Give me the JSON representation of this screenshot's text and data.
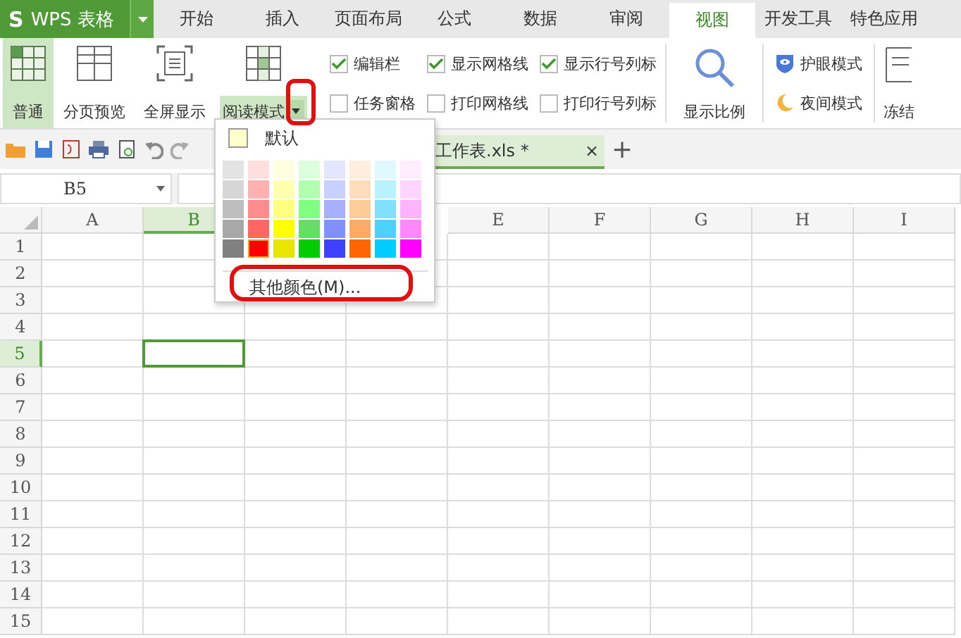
{
  "app": {
    "logo": "S",
    "name": "WPS 表格"
  },
  "tabs": [
    {
      "label": "开始",
      "selected": false
    },
    {
      "label": "插入",
      "selected": false
    },
    {
      "label": "页面布局",
      "selected": false
    },
    {
      "label": "公式",
      "selected": false
    },
    {
      "label": "数据",
      "selected": false
    },
    {
      "label": "审阅",
      "selected": false
    },
    {
      "label": "视图",
      "selected": true
    },
    {
      "label": "开发工具",
      "selected": false
    },
    {
      "label": "特色应用",
      "selected": false
    }
  ],
  "view_buttons": [
    {
      "label": "普通",
      "kind": "normal",
      "selected": true
    },
    {
      "label": "分页预览",
      "kind": "pagebreak",
      "selected": false
    },
    {
      "label": "全屏显示",
      "kind": "fullscreen",
      "selected": false
    },
    {
      "label": "阅读模式",
      "kind": "reading",
      "selected": false
    }
  ],
  "checkbox_columns": [
    [
      {
        "label": "编辑栏",
        "checked": true
      },
      {
        "label": "任务窗格",
        "checked": false
      }
    ],
    [
      {
        "label": "显示网格线",
        "checked": true
      },
      {
        "label": "打印网格线",
        "checked": false
      }
    ],
    [
      {
        "label": "显示行号列标",
        "checked": true
      },
      {
        "label": "打印行号列标",
        "checked": false
      }
    ]
  ],
  "zoom_button": {
    "label": "显示比例"
  },
  "mode_buttons": [
    {
      "label": "护眼模式",
      "kind": "eye"
    },
    {
      "label": "夜间模式",
      "kind": "night"
    }
  ],
  "freeze_button": {
    "label": "冻结"
  },
  "document_tab": {
    "title": "工作表.xls *",
    "close": "×",
    "add": "+"
  },
  "name_box": {
    "value": "B5"
  },
  "color_menu": {
    "default_label": "默认",
    "swatches": [
      [
        {
          "color": "#e3e3e3",
          "selected": false
        },
        {
          "color": "#ffdede",
          "selected": false
        },
        {
          "color": "#ffffe0",
          "selected": false
        },
        {
          "color": "#dcffdc",
          "selected": false
        },
        {
          "color": "#e2e6ff",
          "selected": false
        },
        {
          "color": "#ffeedd",
          "selected": false
        },
        {
          "color": "#e0f8ff",
          "selected": false
        },
        {
          "color": "#ffeeff",
          "selected": false
        }
      ],
      [
        {
          "color": "#d6d6d6",
          "selected": false
        },
        {
          "color": "#ffb0b0",
          "selected": false
        },
        {
          "color": "#ffffb0",
          "selected": false
        },
        {
          "color": "#b0ffb0",
          "selected": false
        },
        {
          "color": "#c8d0ff",
          "selected": false
        },
        {
          "color": "#ffdcbc",
          "selected": false
        },
        {
          "color": "#b8f2ff",
          "selected": false
        },
        {
          "color": "#ffd4ff",
          "selected": false
        }
      ],
      [
        {
          "color": "#bdbdbd",
          "selected": false
        },
        {
          "color": "#ff8c8c",
          "selected": false
        },
        {
          "color": "#ffff80",
          "selected": false
        },
        {
          "color": "#80ff80",
          "selected": false
        },
        {
          "color": "#a6b0ff",
          "selected": false
        },
        {
          "color": "#ffcc99",
          "selected": false
        },
        {
          "color": "#80e0ff",
          "selected": false
        },
        {
          "color": "#ffb3ff",
          "selected": false
        }
      ],
      [
        {
          "color": "#a8a8a8",
          "selected": false
        },
        {
          "color": "#ff6666",
          "selected": false
        },
        {
          "color": "#ffff00",
          "selected": false
        },
        {
          "color": "#66dd66",
          "selected": false
        },
        {
          "color": "#8090ff",
          "selected": false
        },
        {
          "color": "#ffaa66",
          "selected": false
        },
        {
          "color": "#4dd2ff",
          "selected": false
        },
        {
          "color": "#ff88ff",
          "selected": false
        }
      ],
      [
        {
          "color": "#808080",
          "selected": false
        },
        {
          "color": "#ff0000",
          "selected": true
        },
        {
          "color": "#e6e600",
          "selected": false
        },
        {
          "color": "#00cc00",
          "selected": false
        },
        {
          "color": "#4040ff",
          "selected": false
        },
        {
          "color": "#ff6600",
          "selected": false
        },
        {
          "color": "#00ccff",
          "selected": false
        },
        {
          "color": "#ff00ff",
          "selected": false
        }
      ]
    ],
    "more_colors": "其他颜色(M)..."
  },
  "columns": [
    {
      "label": "A",
      "selected": false
    },
    {
      "label": "B",
      "selected": true
    },
    {
      "label": "E",
      "selected": false
    },
    {
      "label": "F",
      "selected": false
    },
    {
      "label": "G",
      "selected": false
    },
    {
      "label": "H",
      "selected": false
    },
    {
      "label": "I",
      "selected": false
    }
  ],
  "rows": [
    {
      "label": "1",
      "selected": false
    },
    {
      "label": "2",
      "selected": false
    },
    {
      "label": "3",
      "selected": false
    },
    {
      "label": "4",
      "selected": false
    },
    {
      "label": "5",
      "selected": true
    },
    {
      "label": "6",
      "selected": false
    },
    {
      "label": "7",
      "selected": false
    },
    {
      "label": "8",
      "selected": false
    },
    {
      "label": "9",
      "selected": false
    },
    {
      "label": "10",
      "selected": false
    },
    {
      "label": "11",
      "selected": false
    },
    {
      "label": "12",
      "selected": false
    },
    {
      "label": "13",
      "selected": false
    },
    {
      "label": "14",
      "selected": false
    },
    {
      "label": "15",
      "selected": false
    }
  ]
}
